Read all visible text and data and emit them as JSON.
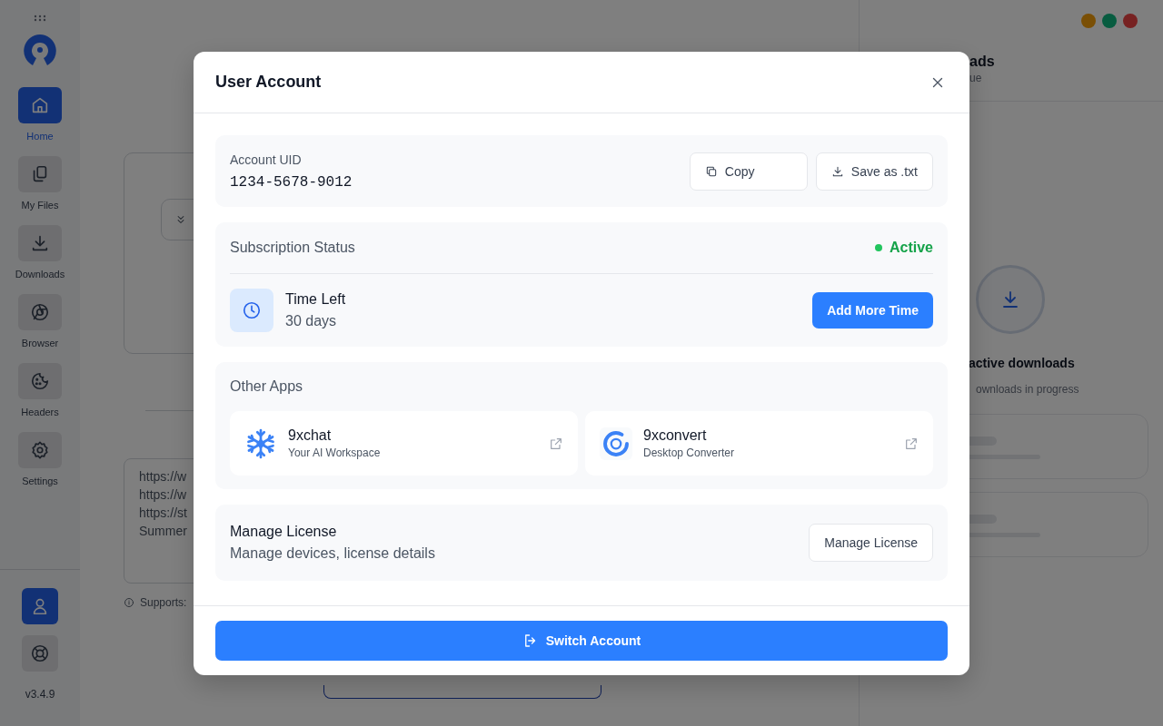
{
  "sidebar": {
    "items": [
      {
        "label": "Home",
        "selected": true
      },
      {
        "label": "My Files",
        "selected": false
      },
      {
        "label": "Downloads",
        "selected": false
      },
      {
        "label": "Browser",
        "selected": false
      },
      {
        "label": "Headers",
        "selected": false
      },
      {
        "label": "Settings",
        "selected": false
      }
    ],
    "bottom": [
      {
        "selected": true
      },
      {
        "selected": false
      }
    ],
    "version": "v3.4.9"
  },
  "main": {
    "input_lines": [
      "https://w",
      "https://w",
      "https://st",
      "Summer"
    ],
    "supports_label": "Supports:"
  },
  "right_panel": {
    "title": "ads",
    "subtitle": "ue",
    "empty_title": "active downloads",
    "empty_subtitle": "ownloads in progress"
  },
  "dialog": {
    "title": "User Account",
    "uid": {
      "label": "Account UID",
      "value": "1234-5678-9012",
      "buttons": [
        "Copy",
        "Save as .txt"
      ]
    },
    "subscription": {
      "label": "Subscription Status",
      "status": "Active",
      "active": true,
      "time_label": "Time Left",
      "time_value": "30 days",
      "button": "Add More Time"
    },
    "other_apps": {
      "label": "Other Apps",
      "apps": [
        {
          "name": "9xchat",
          "description": "Your AI Workspace"
        },
        {
          "name": "9xconvert",
          "description": "Desktop Converter"
        }
      ]
    },
    "license": {
      "title": "Manage License",
      "description": "Manage devices, license details",
      "button": "Manage License"
    },
    "footer_button": "Switch Account"
  }
}
